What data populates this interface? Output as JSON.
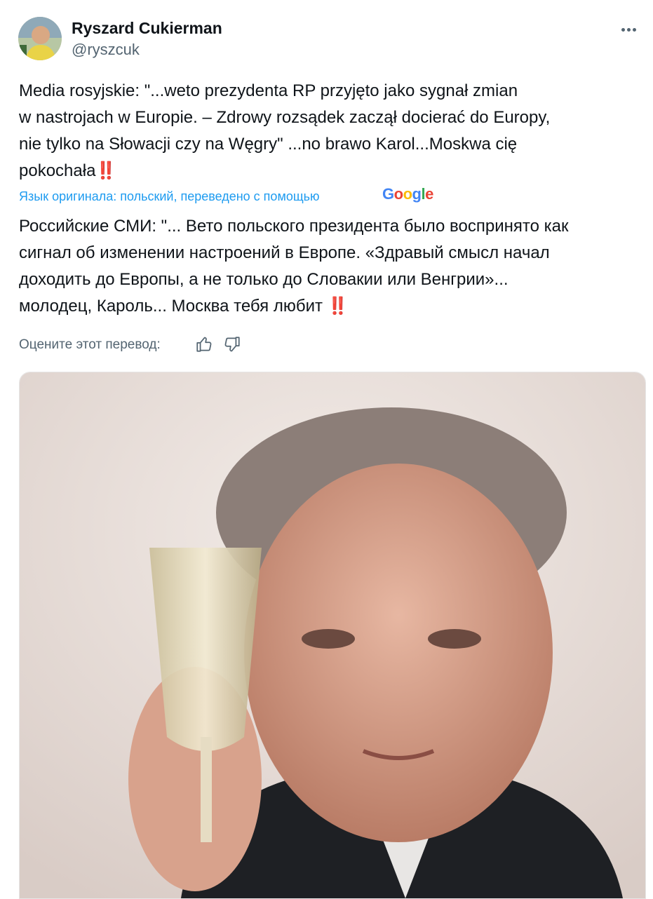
{
  "post": {
    "author_name": "Ryszard Cukierman",
    "author_handle": "@ryszcuk",
    "more_icon": "more-horizontal-icon",
    "original_text": "Media rosyjskie: \"...weto prezydenta RP przyjęto jako sygnał zmian\nw nastrojach w Europie. – Zdrowy rozsądek zaczął docierać do Europy,\nnie tylko na  Słowacji czy na Węgry\" ...no brawo Karol...Moskwa cię\npokochała",
    "original_emoji": "‼️",
    "translation_note": "Язык оригинала: польский, переведено с помощью",
    "translation_provider": "Google",
    "translated_text": "Российские СМИ: \"... Вето польского президента было воспринято как\nсигнал об изменении настроений в Европе. «Здравый смысл начал\nдоходить до Европы, а не только до Словакии или Венгрии»...\nмолодец, Кароль... Москва тебя любит ",
    "translated_emoji": "‼️",
    "rate_label": "Оцените этот перевод:",
    "thumbs_up_icon": "thumbs-up-icon",
    "thumbs_down_icon": "thumbs-down-icon"
  },
  "colors": {
    "link": "#1d9bf0",
    "secondary": "#536471",
    "text": "#0f1419",
    "accent_red": "#c0101e"
  }
}
